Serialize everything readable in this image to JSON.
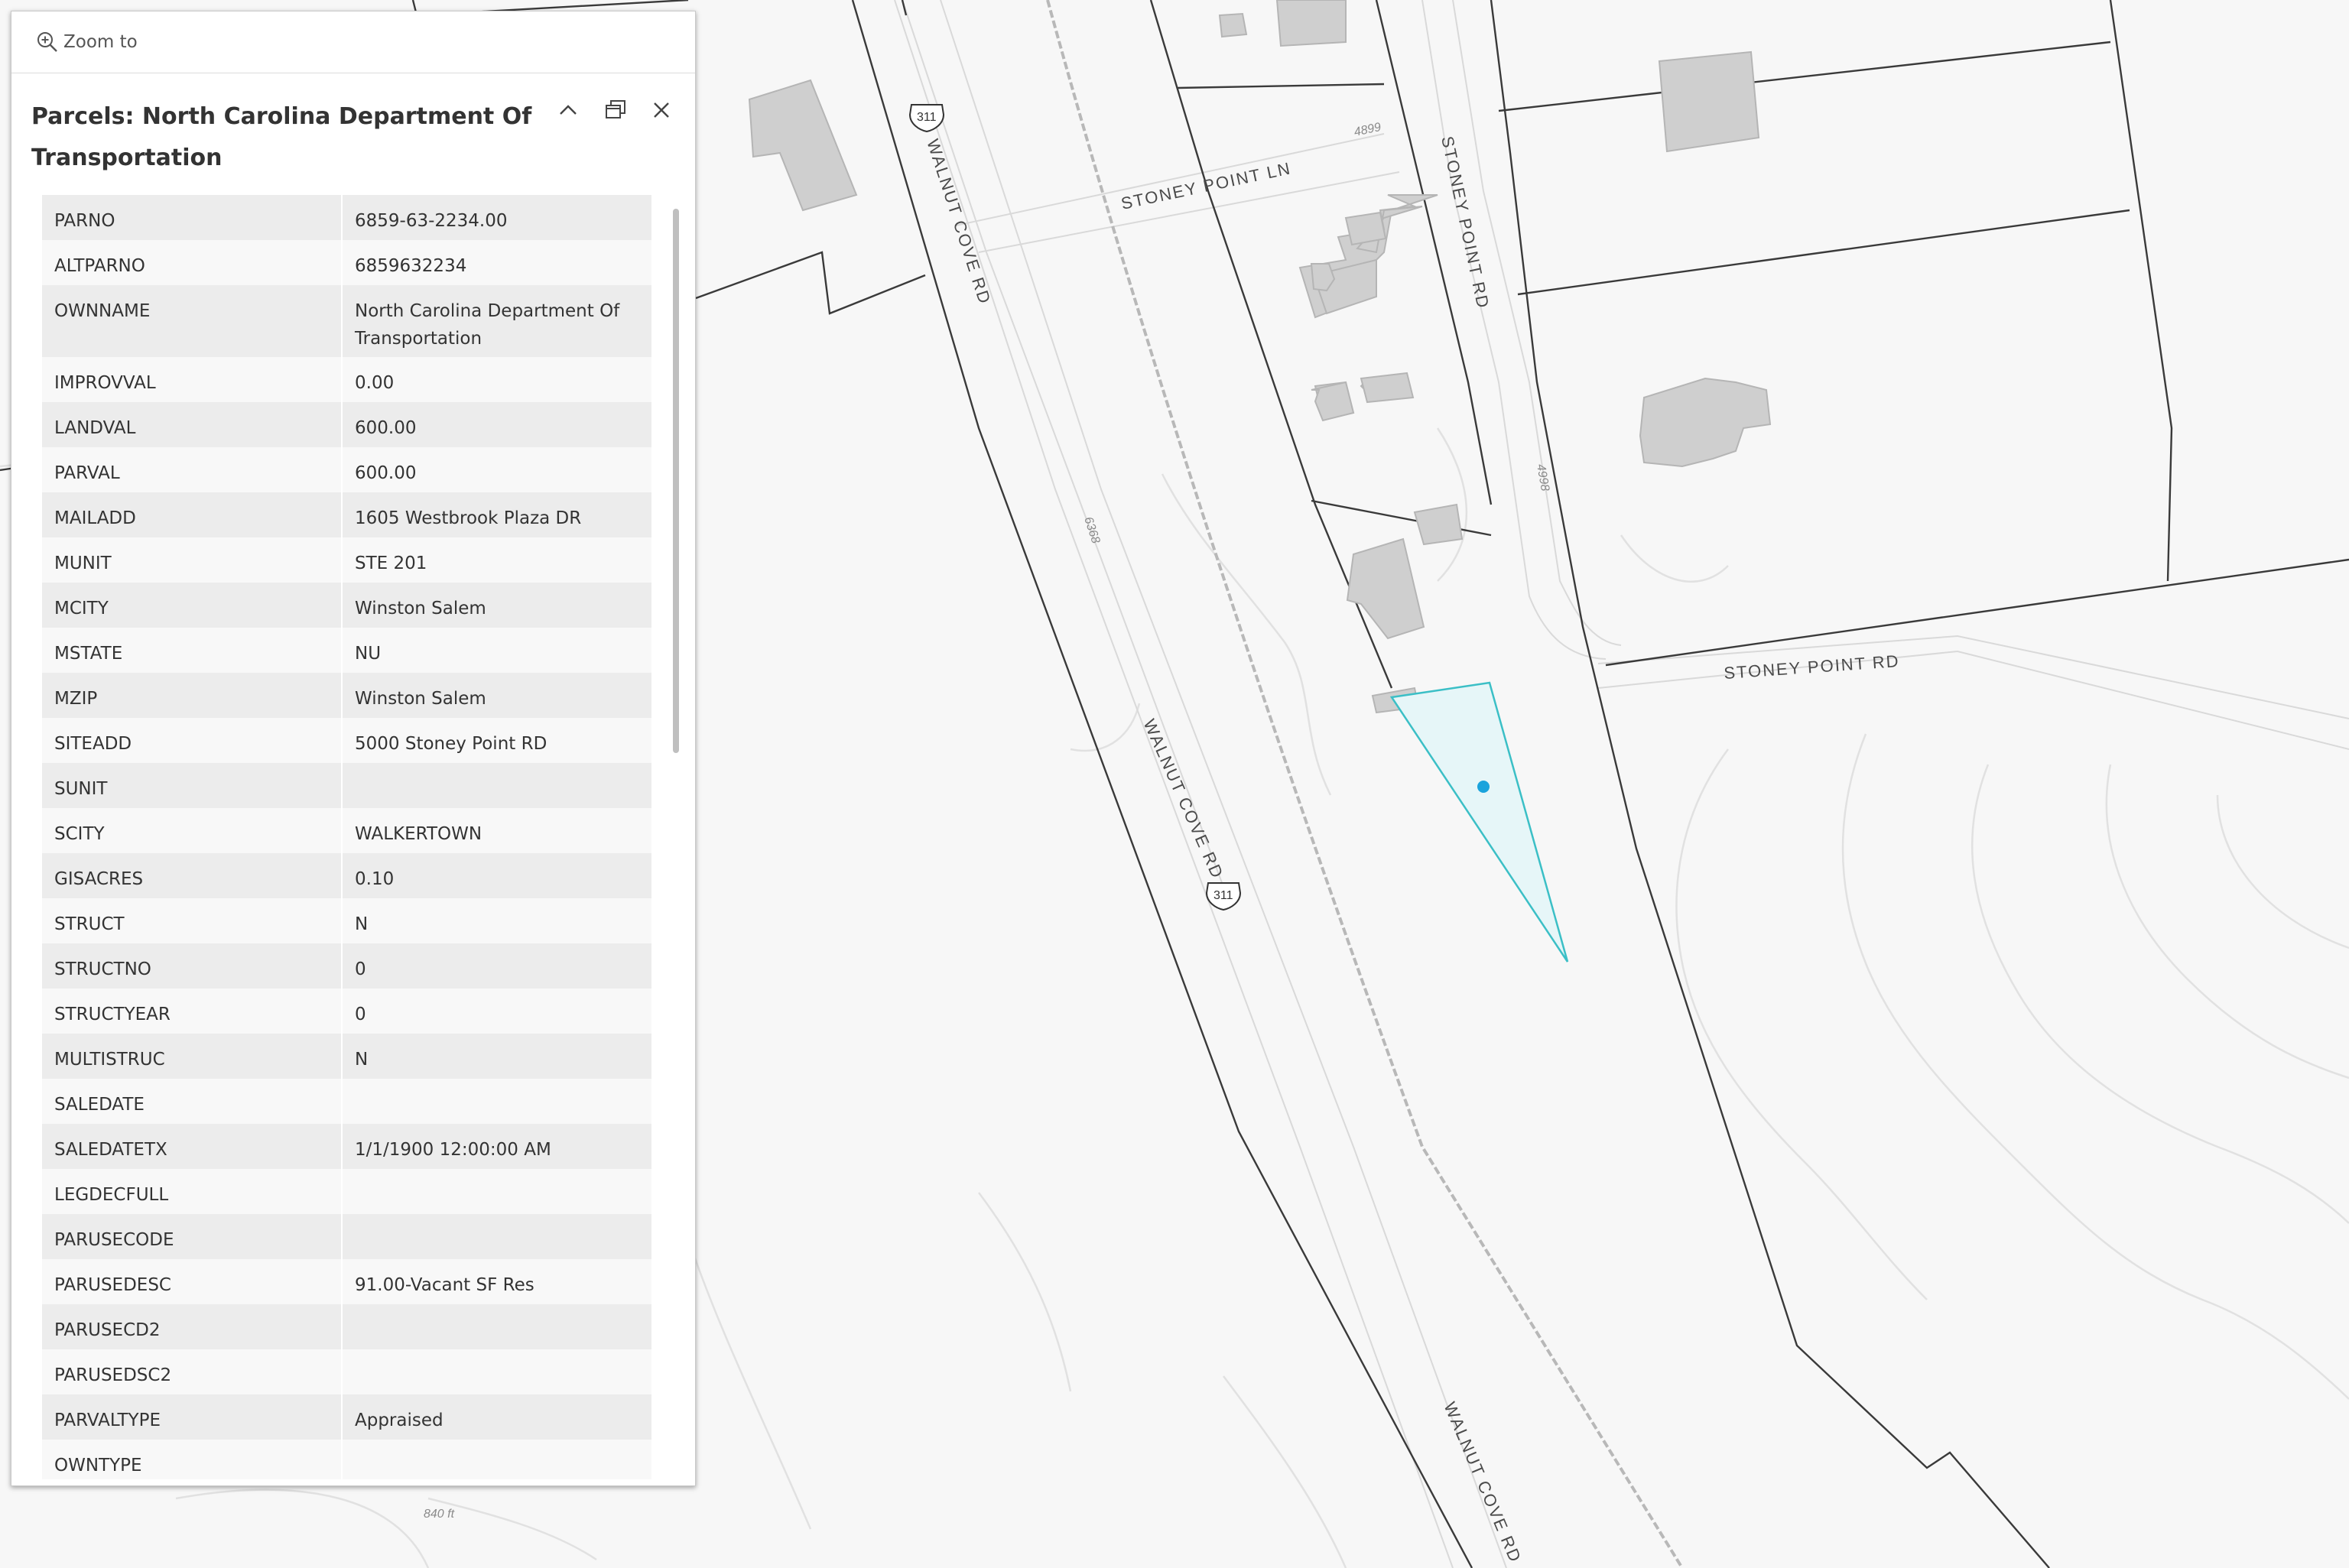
{
  "toolbar": {
    "zoom_label": "Zoom to"
  },
  "popup": {
    "title": "Parcels: North Carolina Department Of Transportation",
    "rows": [
      {
        "key": "PARNO",
        "value": "6859-63-2234.00"
      },
      {
        "key": "ALTPARNO",
        "value": "6859632234"
      },
      {
        "key": "OWNNAME",
        "value": "North Carolina Department Of Transportation"
      },
      {
        "key": "IMPROVVAL",
        "value": "0.00"
      },
      {
        "key": "LANDVAL",
        "value": "600.00"
      },
      {
        "key": "PARVAL",
        "value": "600.00"
      },
      {
        "key": "MAILADD",
        "value": "1605 Westbrook Plaza DR"
      },
      {
        "key": "MUNIT",
        "value": "STE 201"
      },
      {
        "key": "MCITY",
        "value": "Winston Salem"
      },
      {
        "key": "MSTATE",
        "value": "NU"
      },
      {
        "key": "MZIP",
        "value": "Winston Salem"
      },
      {
        "key": "SITEADD",
        "value": "5000 Stoney Point RD"
      },
      {
        "key": "SUNIT",
        "value": ""
      },
      {
        "key": "SCITY",
        "value": "WALKERTOWN"
      },
      {
        "key": "GISACRES",
        "value": "0.10"
      },
      {
        "key": "STRUCT",
        "value": "N"
      },
      {
        "key": "STRUCTNO",
        "value": "0"
      },
      {
        "key": "STRUCTYEAR",
        "value": "0"
      },
      {
        "key": "MULTISTRUC",
        "value": "N"
      },
      {
        "key": "SALEDATE",
        "value": ""
      },
      {
        "key": "SALEDATETX",
        "value": "1/1/1900 12:00:00 AM"
      },
      {
        "key": "LEGDECFULL",
        "value": ""
      },
      {
        "key": "PARUSECODE",
        "value": ""
      },
      {
        "key": "PARUSEDESC",
        "value": "91.00-Vacant SF Res"
      },
      {
        "key": "PARUSECD2",
        "value": ""
      },
      {
        "key": "PARUSEDSC2",
        "value": ""
      },
      {
        "key": "PARVALTYPE",
        "value": "Appraised"
      },
      {
        "key": "OWNTYPE",
        "value": ""
      }
    ]
  },
  "map": {
    "road_labels": {
      "walnut_cove_1": "WALNUT COVE RD",
      "walnut_cove_2": "WALNUT COVE RD",
      "walnut_cove_3": "WALNUT COVE RD",
      "stoney_point_ln": "STONEY POINT LN",
      "stoney_point_rd_1": "STONEY POINT RD",
      "stoney_point_rd_2": "STONEY POINT RD"
    },
    "route_shield": "311",
    "address_numbers": {
      "a": "4899",
      "b": "4998",
      "c": "6368"
    },
    "contour_label": "840 ft",
    "colors": {
      "selection": "#3bbfc6",
      "selection_fill": "#e6f6f8",
      "point": "#1aa3dc",
      "parcel_line": "#333333",
      "building": "#cfcfcf"
    }
  }
}
